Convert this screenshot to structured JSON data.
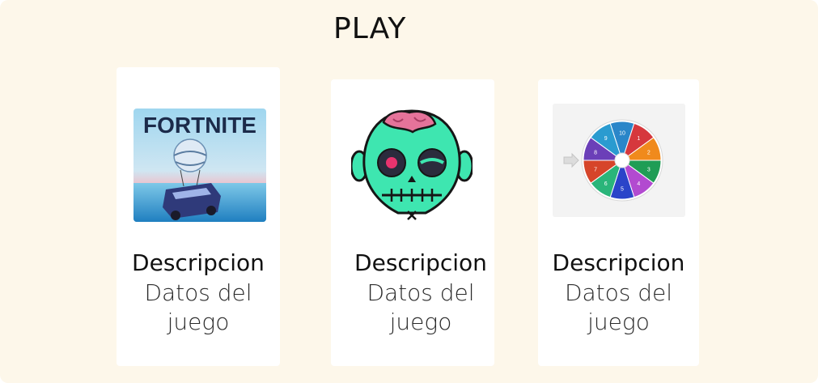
{
  "header": {
    "title": "PLAY"
  },
  "games": [
    {
      "thumbnail_text": "FORTNITE",
      "title": "Descripcion",
      "line1": "Datos del",
      "line2": "juego"
    },
    {
      "title": "Descripcion",
      "line1": "Datos del",
      "line2": "juego"
    },
    {
      "wheel_numbers": [
        "1",
        "2",
        "3",
        "4",
        "5",
        "6",
        "7",
        "8",
        "9",
        "10"
      ],
      "title": "Descripcion",
      "line1": "Datos del",
      "line2": "juego"
    }
  ],
  "colors": {
    "background": "#fdf7ea",
    "card": "#ffffff",
    "zombie_skin": "#3ee6b0",
    "zombie_brain": "#e5739a"
  }
}
